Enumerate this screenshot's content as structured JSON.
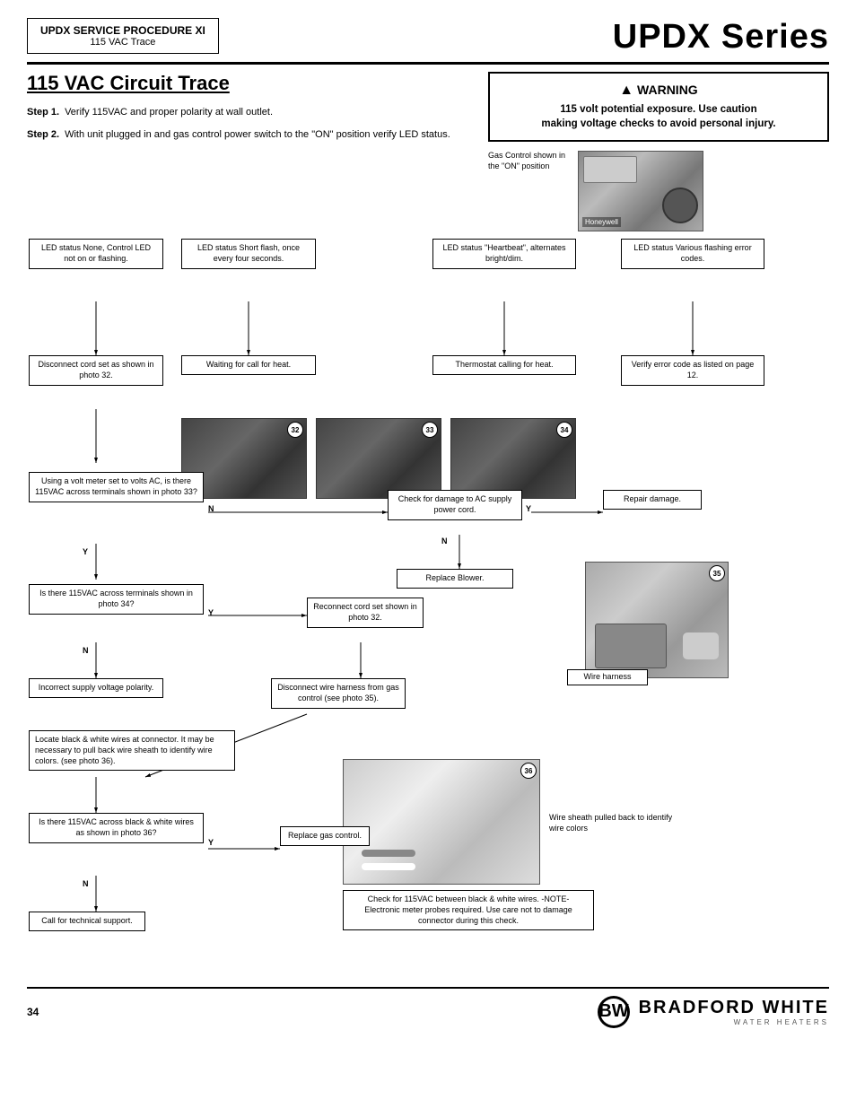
{
  "header": {
    "procedure_line1": "UPDX SERVICE PROCEDURE  XI",
    "procedure_line2": "115 VAC Trace",
    "series_title": "UPDX Series"
  },
  "section": {
    "title": "115 VAC Circuit Trace"
  },
  "warning": {
    "icon": "▲",
    "title": "WARNING",
    "line1": "115 volt potential exposure. Use caution",
    "line2": "making voltage checks to avoid personal injury."
  },
  "steps": {
    "step1_label": "Step 1.",
    "step1_text": "Verify 115VAC and proper polarity at wall outlet.",
    "step2_label": "Step 2.",
    "step2_text": "With unit plugged in and gas control power switch to the \"ON\" position verify LED status."
  },
  "gas_control_caption": "Gas Control shown in the \"ON\" position",
  "led_boxes": [
    {
      "id": "led1",
      "text": "LED status\nNone, Control LED not\non or flashing."
    },
    {
      "id": "led2",
      "text": "LED status\nShort flash, once every\nfour seconds."
    },
    {
      "id": "led3",
      "text": "LED status\n\"Heartbeat\", alternates\nbright/dim."
    },
    {
      "id": "led4",
      "text": "LED status\nVarious flashing error\ncodes."
    }
  ],
  "action_boxes": {
    "waiting": "Waiting for\ncall for heat.",
    "thermostat": "Thermostat calling\nfor heat.",
    "verify_error": "Verify error code as\nlisted on page 12."
  },
  "photos": {
    "p32_num": "32",
    "p33_num": "33",
    "p34_num": "34",
    "p35_num": "35",
    "p36_num": "36"
  },
  "flow_nodes": {
    "disconnect_cord": "Disconnect cord set as\nshown in photo 32.",
    "voltmeter_q": "Using a volt meter set to\nvolts AC, is there 115VAC\nacross terminals shown\nin photo 33?",
    "115vac_q": "Is there 115VAC across\nterminals shown in\nphoto 34?",
    "incorrect_polarity": "Incorrect supply\nvoltage polarity.",
    "reconnect_cord": "Reconnect cord set\nshown in photo 32.",
    "disconnect_wire": "Disconnect wire harness\nfrom gas control\n(see photo 35).",
    "check_damage": "Check for damage to AC\nsupply power cord.",
    "repair_damage": "Repair damage.",
    "replace_blower": "Replace Blower.",
    "wire_harness_label": "Wire harness",
    "locate_wires": "Locate black & white wires at connector. It\nmay be necessary to pull back wire sheath\nto identify wire colors.\n(see photo 36).",
    "wire_sheath_label": "Wire sheath pulled back to\nidentify wire colors",
    "115vac_bw_q": "Is there 115VAC across\nblack & white wires as\nshown in photo 36?",
    "replace_gas": "Replace gas\ncontrol.",
    "call_tech": "Call for technical\nsupport.",
    "check_115_note": "Check for 115VAC between black & white wires.\n-NOTE-\nElectronic meter probes required. Use care not to\ndamage connector during this check."
  },
  "connectors": {
    "n": "N",
    "y": "Y"
  },
  "footer": {
    "page_num": "34",
    "brand_name": "BRADFORD WHITE",
    "brand_sub": "WATER HEATERS"
  }
}
